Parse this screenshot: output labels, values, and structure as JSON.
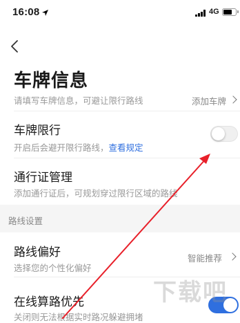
{
  "status_bar": {
    "time": "16:08",
    "network": "4G"
  },
  "header": {
    "title": "车牌信息",
    "subtitle": "请填写车牌信息，可避让限行路线",
    "add_plate": "添加车牌"
  },
  "rows": {
    "plate_limit": {
      "title": "车牌限行",
      "desc": "开启后会避开限行路线，",
      "link": "查看规定",
      "enabled": false
    },
    "permit": {
      "title": "通行证管理",
      "desc": "添加通行证后，可规划穿过限行区域的路线"
    }
  },
  "route_section": {
    "label": "路线设置",
    "preference": {
      "title": "路线偏好",
      "desc": "选择您的个性化偏好",
      "value": "智能推荐"
    },
    "online": {
      "title": "在线算路优先",
      "desc": "关闭则无法根据实时路况躲避拥堵",
      "enabled": true
    }
  },
  "overlay": {
    "annotation_color": "#e8202a",
    "watermark": "下载吧"
  }
}
